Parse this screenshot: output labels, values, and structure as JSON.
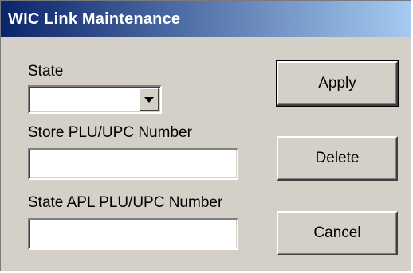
{
  "window": {
    "title": "WIC Link Maintenance"
  },
  "form": {
    "state_label": "State",
    "state_value": "",
    "store_plu_label": "Store PLU/UPC Number",
    "store_plu_value": "",
    "state_apl_label": "State APL PLU/UPC Number",
    "state_apl_value": ""
  },
  "buttons": {
    "apply": "Apply",
    "delete": "Delete",
    "cancel": "Cancel"
  },
  "colors": {
    "title_gradient_start": "#0a246a",
    "title_gradient_end": "#a6caf0",
    "face": "#d4d0c8"
  }
}
